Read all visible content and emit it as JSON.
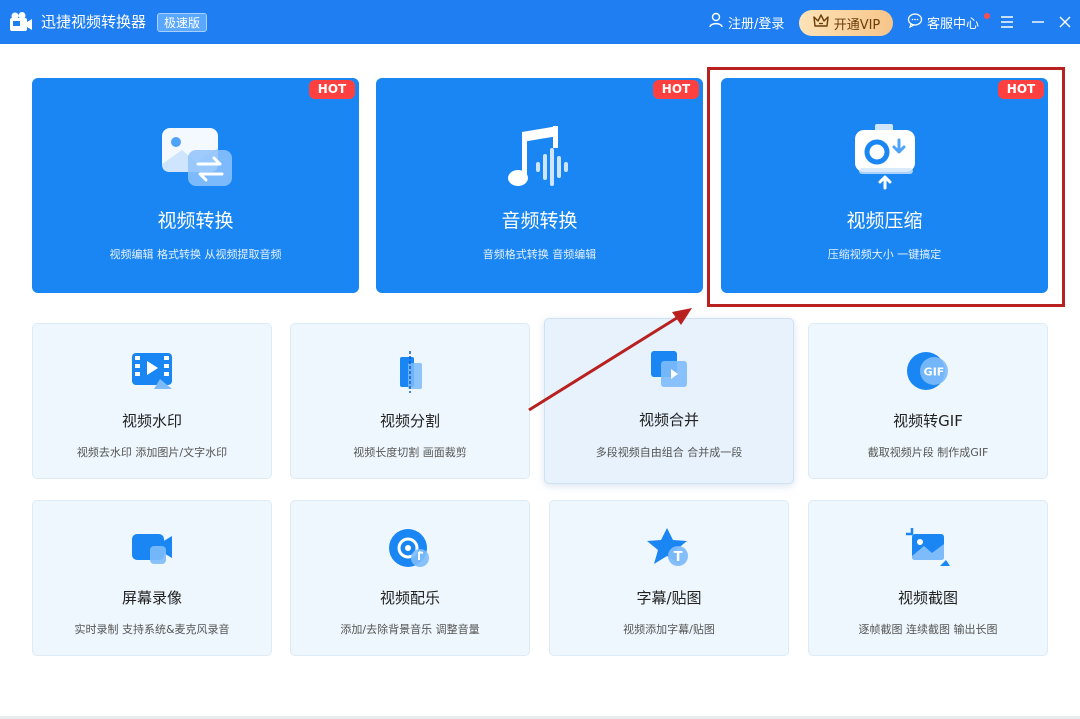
{
  "titlebar": {
    "app_title": "迅捷视频转换器",
    "edition": "极速版",
    "login_label": "注册/登录",
    "vip_label": "开通VIP",
    "service_label": "客服中心"
  },
  "big_cards": [
    {
      "title": "视频转换",
      "desc": "视频编辑 格式转换 从视频提取音频",
      "tag": "HOT",
      "icon": "video-convert-icon"
    },
    {
      "title": "音频转换",
      "desc": "音频格式转换 音频编辑",
      "tag": "HOT",
      "icon": "audio-convert-icon"
    },
    {
      "title": "视频压缩",
      "desc": "压缩视频大小 一键搞定",
      "tag": "HOT",
      "icon": "video-compress-icon"
    }
  ],
  "small_cards": [
    {
      "title": "视频水印",
      "desc": "视频去水印 添加图片/文字水印",
      "icon": "watermark-icon"
    },
    {
      "title": "视频分割",
      "desc": "视频长度切割 画面裁剪",
      "icon": "split-icon"
    },
    {
      "title": "视频合并",
      "desc": "多段视频自由组合 合并成一段",
      "icon": "merge-icon"
    },
    {
      "title": "视频转GIF",
      "desc": "截取视频片段 制作成GIF",
      "icon": "gif-icon",
      "icon_text": "GIF"
    },
    {
      "title": "屏幕录像",
      "desc": "实时录制 支持系统&麦克风录音",
      "icon": "screen-record-icon"
    },
    {
      "title": "视频配乐",
      "desc": "添加/去除背景音乐 调整音量",
      "icon": "music-icon"
    },
    {
      "title": "字幕/贴图",
      "desc": "视频添加字幕/贴图",
      "icon": "subtitle-icon",
      "icon_text": "T"
    },
    {
      "title": "视频截图",
      "desc": "逐帧截图 连续截图 输出长图",
      "icon": "screenshot-icon"
    }
  ],
  "colors": {
    "titlebar": "#1f7ef2",
    "big_card": "#1a86f3",
    "hot_tag": "#ff4040",
    "highlight": "#b8211f",
    "small_card": "#eef7fd"
  }
}
